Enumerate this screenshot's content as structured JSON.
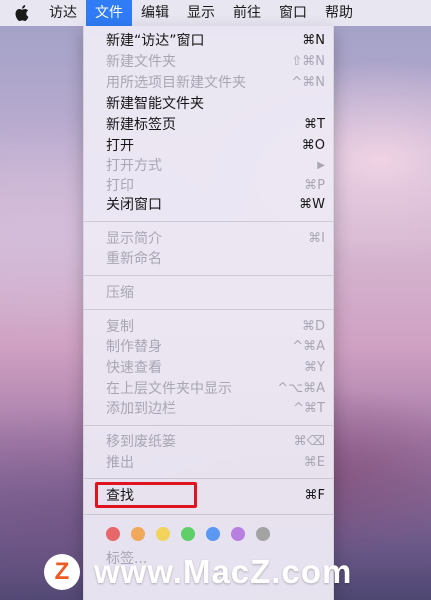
{
  "menubar": {
    "items": [
      "访达",
      "文件",
      "编辑",
      "显示",
      "前往",
      "窗口",
      "帮助"
    ],
    "active_index": 1
  },
  "menu": {
    "items": [
      {
        "label": "新建“访达”窗口",
        "shortcut": "⌘N",
        "enabled": true
      },
      {
        "label": "新建文件夹",
        "shortcut": "⇧⌘N",
        "enabled": false
      },
      {
        "label": "用所选项目新建文件夹",
        "shortcut": "^⌘N",
        "enabled": false
      },
      {
        "label": "新建智能文件夹",
        "shortcut": "",
        "enabled": true
      },
      {
        "label": "新建标签页",
        "shortcut": "⌘T",
        "enabled": true
      },
      {
        "label": "打开",
        "shortcut": "⌘O",
        "enabled": true
      },
      {
        "label": "打开方式",
        "shortcut": "▶",
        "enabled": false
      },
      {
        "label": "打印",
        "shortcut": "⌘P",
        "enabled": false
      },
      {
        "label": "关闭窗口",
        "shortcut": "⌘W",
        "enabled": true
      },
      {
        "label": "显示简介",
        "shortcut": "⌘I",
        "enabled": false
      },
      {
        "label": "重新命名",
        "shortcut": "",
        "enabled": false
      },
      {
        "label": "压缩",
        "shortcut": "",
        "enabled": false
      },
      {
        "label": "复制",
        "shortcut": "⌘D",
        "enabled": false
      },
      {
        "label": "制作替身",
        "shortcut": "^⌘A",
        "enabled": false
      },
      {
        "label": "快速查看",
        "shortcut": "⌘Y",
        "enabled": false
      },
      {
        "label": "在上层文件夹中显示",
        "shortcut": "^⌥⌘A",
        "enabled": false
      },
      {
        "label": "添加到边栏",
        "shortcut": "^⌘T",
        "enabled": false
      },
      {
        "label": "移到废纸篓",
        "shortcut": "⌘⌫",
        "enabled": false
      },
      {
        "label": "推出",
        "shortcut": "⌘E",
        "enabled": false
      },
      {
        "label": "查找",
        "shortcut": "⌘F",
        "enabled": true
      },
      {
        "label": "标签...",
        "shortcut": "",
        "enabled": false
      }
    ],
    "tag_colors": [
      "#e8676b",
      "#f0a85a",
      "#f2d45c",
      "#5fcf6a",
      "#5a98f2",
      "#b77fe0",
      "#a3a3a3"
    ]
  },
  "watermark": {
    "text": "www.MacZ.com",
    "logo_letter": "Z"
  }
}
